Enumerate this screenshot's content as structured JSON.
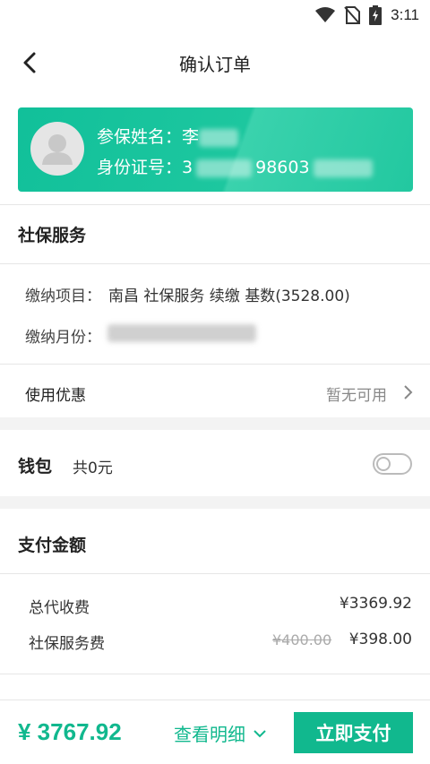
{
  "status_bar": {
    "time": "3:11",
    "icons": [
      "wifi-icon",
      "no-sim-icon",
      "battery-charging-icon"
    ]
  },
  "nav": {
    "title": "确认订单",
    "back_icon": "chevron-left-icon"
  },
  "insured": {
    "name_label": "参保姓名：",
    "name_value": "李",
    "id_label": "身份证号：",
    "id_prefix": "3",
    "id_middle": "98603"
  },
  "social_service": {
    "title": "社保服务",
    "item_label": "缴纳项目：",
    "item_value": "南昌 社保服务 续缴 基数(3528.00)",
    "month_label": "缴纳月份："
  },
  "discount": {
    "label": "使用优惠",
    "value": "暂无可用"
  },
  "wallet": {
    "label": "钱包",
    "balance": "共0元",
    "enabled": false
  },
  "payment": {
    "title": "支付金额",
    "rows": [
      {
        "label": "总代收费",
        "price": "¥3369.92"
      },
      {
        "label": "社保服务费",
        "original": "¥400.00",
        "price": "¥398.00"
      }
    ]
  },
  "bottom": {
    "total": "¥ 3767.92",
    "detail_label": "查看明细",
    "pay_label": "立即支付"
  },
  "colors": {
    "accent": "#11b88e",
    "card": "#1dc79f",
    "background": "#f3f3f3"
  }
}
